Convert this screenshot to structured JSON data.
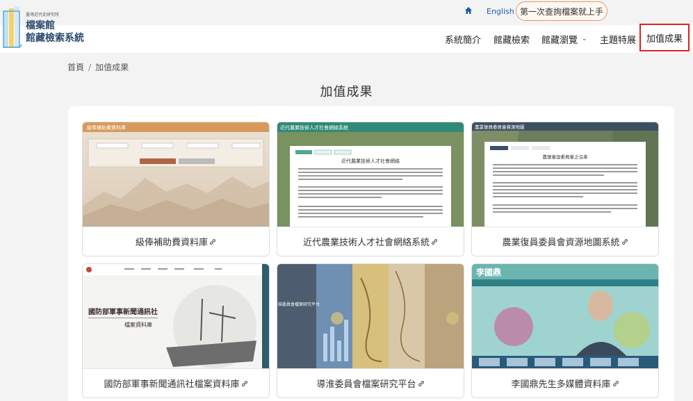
{
  "topbar": {
    "lang_label": "English",
    "first_button": "第一次查詢檔案就上手"
  },
  "logo": {
    "small": "臺灣近代史研究所",
    "title1": "檔案館",
    "title2": "館藏檢索系統"
  },
  "nav": {
    "items": [
      {
        "label": "系統簡介"
      },
      {
        "label": "館藏檢索"
      },
      {
        "label": "館藏瀏覽"
      },
      {
        "label": "主題特展"
      },
      {
        "label": "加值成果"
      }
    ]
  },
  "breadcrumb": {
    "home": "首頁",
    "sep": "/",
    "current": "加值成果"
  },
  "page_title": "加值成果",
  "cards": [
    {
      "title": "級俸補助費資料庫",
      "thumb_header": "級俸補助費資料庫"
    },
    {
      "title": "近代農業技術人才社會網絡系統",
      "thumb_header": "近代農業技術人才社會網絡系統",
      "thumb_doc": "近代農業技術人才社會網絡"
    },
    {
      "title": "農業復員委員會資源地圖系統",
      "thumb_header": "農業復員委員會資源地圖",
      "thumb_doc": "農復會設委員會之沿革"
    },
    {
      "title": "國防部軍事新聞通訊社檔案資料庫",
      "thumb_header": "國防部軍事新聞通訊社",
      "thumb_sub": "檔案資料庫"
    },
    {
      "title": "導淮委員會檔案研究平台",
      "thumb_header": "導淮委員會檔案研究平台"
    },
    {
      "title": "李國鼎先生多媒體資料庫",
      "thumb_header": "李國鼎"
    }
  ],
  "colors": {
    "accent_border": "#e29a68",
    "active_nav": "#e02020",
    "link": "#1e5aa8"
  }
}
